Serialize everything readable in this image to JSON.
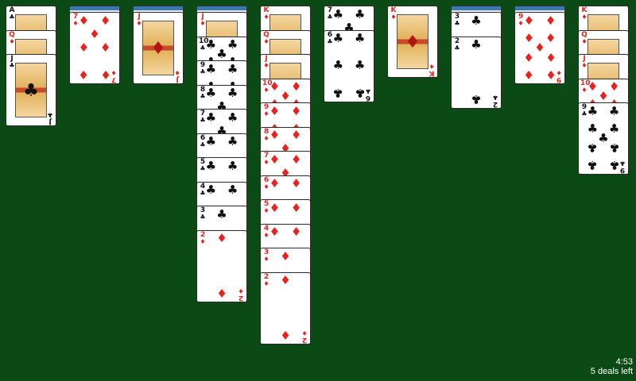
{
  "game": "Spider Solitaire",
  "colors": {
    "felt": "#0b4a14",
    "red_suit": "#e8231f",
    "black_suit": "#111111",
    "card_back_band": "#3a78b5"
  },
  "status": {
    "time": "4:53",
    "deals_left": "5 deals left"
  },
  "columns": [
    {
      "cards": [
        {
          "rank": "A",
          "suit": "♣"
        },
        {
          "rank": "Q",
          "suit": "♦"
        },
        {
          "rank": "J",
          "suit": "♣"
        }
      ]
    },
    {
      "cards": [
        {
          "face_down": true
        },
        {
          "rank": "7",
          "suit": "♦"
        }
      ]
    },
    {
      "cards": [
        {
          "face_down": true
        },
        {
          "rank": "J",
          "suit": "♦"
        }
      ]
    },
    {
      "cards": [
        {
          "face_down": true
        },
        {
          "rank": "J",
          "suit": "♦"
        },
        {
          "rank": "10",
          "suit": "♣"
        },
        {
          "rank": "9",
          "suit": "♣"
        },
        {
          "rank": "8",
          "suit": "♣"
        },
        {
          "rank": "7",
          "suit": "♣"
        },
        {
          "rank": "6",
          "suit": "♣"
        },
        {
          "rank": "5",
          "suit": "♣"
        },
        {
          "rank": "4",
          "suit": "♣"
        },
        {
          "rank": "3",
          "suit": "♣"
        },
        {
          "rank": "2",
          "suit": "♦"
        }
      ]
    },
    {
      "cards": [
        {
          "rank": "K",
          "suit": "♦"
        },
        {
          "rank": "Q",
          "suit": "♦"
        },
        {
          "rank": "J",
          "suit": "♦"
        },
        {
          "rank": "10",
          "suit": "♦"
        },
        {
          "rank": "9",
          "suit": "♦"
        },
        {
          "rank": "8",
          "suit": "♦"
        },
        {
          "rank": "7",
          "suit": "♦"
        },
        {
          "rank": "6",
          "suit": "♦"
        },
        {
          "rank": "5",
          "suit": "♦"
        },
        {
          "rank": "4",
          "suit": "♦"
        },
        {
          "rank": "3",
          "suit": "♦"
        },
        {
          "rank": "2",
          "suit": "♦"
        }
      ]
    },
    {
      "cards": [
        {
          "rank": "7",
          "suit": "♣"
        },
        {
          "rank": "6",
          "suit": "♣"
        }
      ]
    },
    {
      "cards": [
        {
          "rank": "K",
          "suit": "♦"
        }
      ]
    },
    {
      "cards": [
        {
          "face_down": true
        },
        {
          "rank": "3",
          "suit": "♣"
        },
        {
          "rank": "2",
          "suit": "♣"
        }
      ]
    },
    {
      "cards": [
        {
          "face_down": true
        },
        {
          "rank": "9",
          "suit": "♦"
        }
      ]
    },
    {
      "cards": [
        {
          "rank": "K",
          "suit": "♦"
        },
        {
          "rank": "Q",
          "suit": "♦"
        },
        {
          "rank": "J",
          "suit": "♦"
        },
        {
          "rank": "10",
          "suit": "♦"
        },
        {
          "rank": "9",
          "suit": "♣"
        }
      ]
    }
  ]
}
